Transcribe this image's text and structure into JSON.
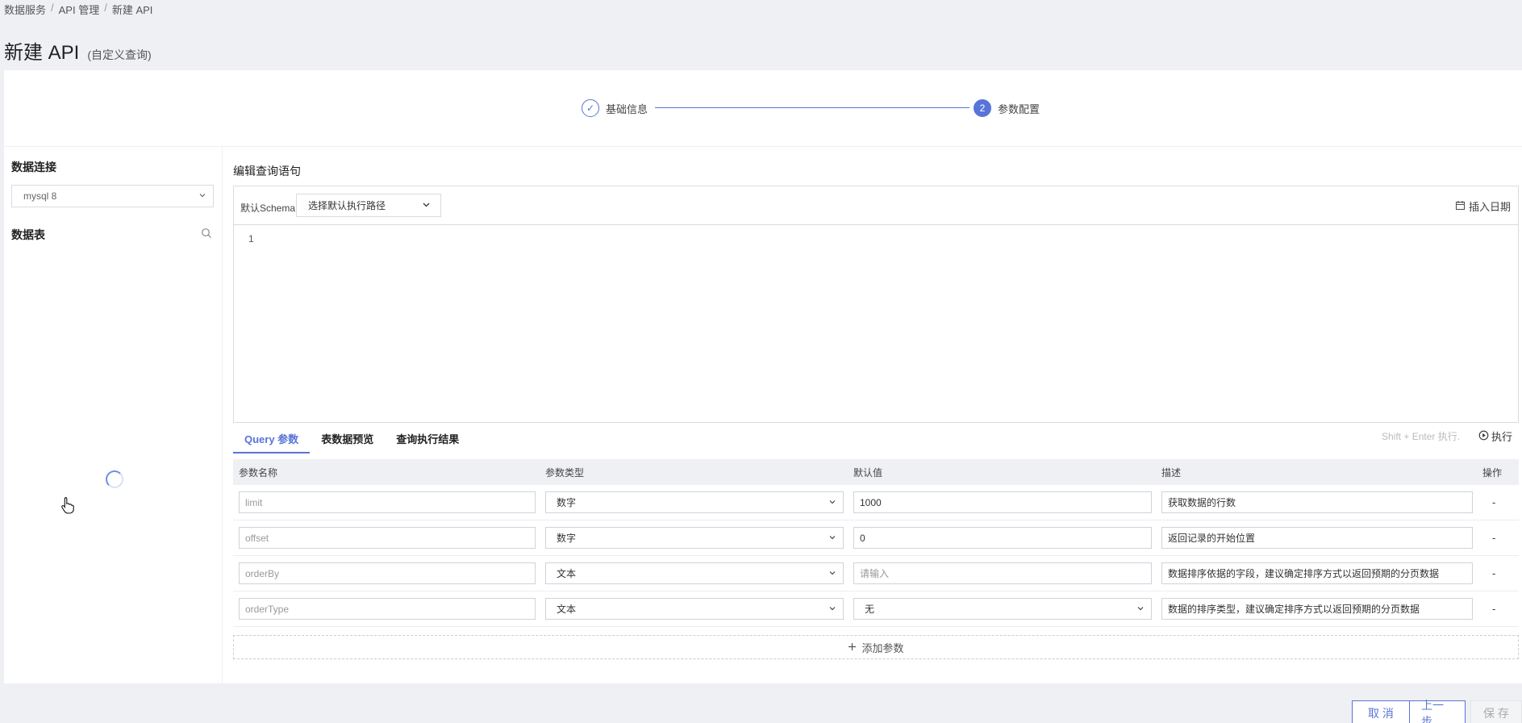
{
  "breadcrumb": {
    "items": [
      "数据服务",
      "API 管理",
      "新建 API"
    ],
    "sep": "/"
  },
  "page": {
    "title": "新建 API",
    "subtitle": "(自定义查询)"
  },
  "steps": [
    {
      "label": "基础信息",
      "state": "done",
      "mark": "✓"
    },
    {
      "label": "参数配置",
      "state": "active",
      "mark": "2"
    }
  ],
  "left": {
    "connection_title": "数据连接",
    "connection_value": "mysql 8",
    "tables_title": "数据表"
  },
  "editor": {
    "title": "编辑查询语句",
    "schema_label": "默认Schema",
    "schema_placeholder": "选择默认执行路径",
    "insert_date": "插入日期",
    "line_number": "1"
  },
  "tabs": [
    "Query 参数",
    "表数据预览",
    "查询执行结果"
  ],
  "run_hint": "Shift + Enter 执行.",
  "run_label": "执行",
  "table": {
    "headers": [
      "参数名称",
      "参数类型",
      "默认值",
      "描述",
      "操作"
    ],
    "rows": [
      {
        "name": "limit",
        "type": "数字",
        "default": "1000",
        "default_placeholder": "",
        "default_is_select": false,
        "desc": "获取数据的行数",
        "op": "-"
      },
      {
        "name": "offset",
        "type": "数字",
        "default": "0",
        "default_placeholder": "",
        "default_is_select": false,
        "desc": "返回记录的开始位置",
        "op": "-"
      },
      {
        "name": "orderBy",
        "type": "文本",
        "default": "",
        "default_placeholder": "请输入",
        "default_is_select": false,
        "desc": "数据排序依据的字段，建议确定排序方式以返回预期的分页数据",
        "op": "-"
      },
      {
        "name": "orderType",
        "type": "文本",
        "default": "无",
        "default_placeholder": "",
        "default_is_select": true,
        "desc": "数据的排序类型，建议确定排序方式以返回预期的分页数据",
        "op": "-"
      }
    ]
  },
  "add_param": "添加参数",
  "footer": {
    "cancel": "取 消",
    "prev": "上一步",
    "save": "保 存"
  },
  "colors": {
    "accent": "#5874d8",
    "bg": "#eef0f4"
  }
}
